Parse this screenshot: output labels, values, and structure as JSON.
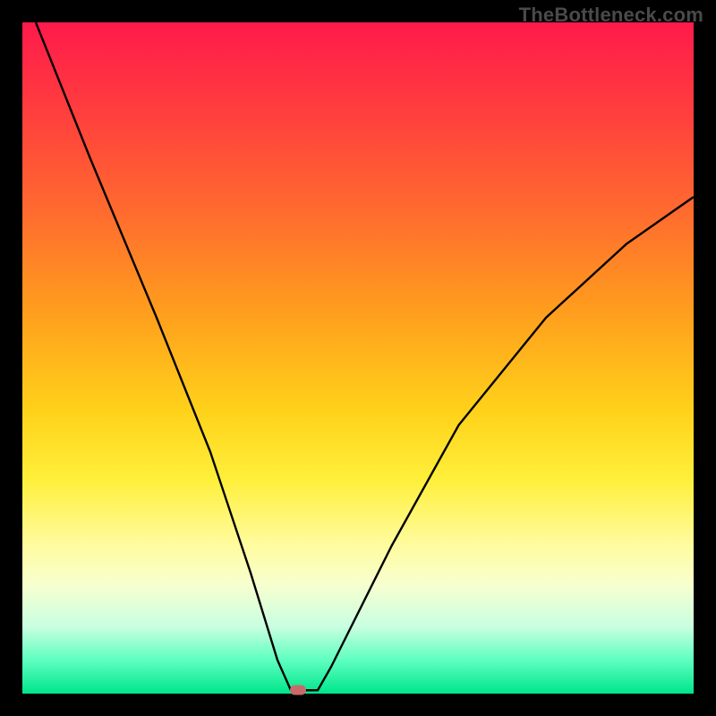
{
  "watermark": "TheBottleneck.com",
  "chart_data": {
    "type": "line",
    "title": "",
    "xlabel": "",
    "ylabel": "",
    "xlim": [
      0,
      100
    ],
    "ylim": [
      0,
      100
    ],
    "grid": false,
    "legend": false,
    "series": [
      {
        "name": "curve",
        "x": [
          2,
          10,
          20,
          28,
          34,
          38,
          40,
          42,
          44,
          46,
          55,
          65,
          78,
          90,
          100
        ],
        "values": [
          100,
          80,
          56,
          36,
          18,
          5,
          0.5,
          0.5,
          0.5,
          4,
          22,
          40,
          56,
          67,
          74
        ]
      }
    ],
    "marker": {
      "x": 41,
      "y": 0.5
    },
    "gradient_stops": [
      {
        "pos": 0,
        "color": "#ff1a4b"
      },
      {
        "pos": 12,
        "color": "#ff3a3f"
      },
      {
        "pos": 28,
        "color": "#ff6a2f"
      },
      {
        "pos": 42,
        "color": "#ff9a1e"
      },
      {
        "pos": 58,
        "color": "#ffd21a"
      },
      {
        "pos": 68,
        "color": "#ffef3a"
      },
      {
        "pos": 78,
        "color": "#fffca0"
      },
      {
        "pos": 84,
        "color": "#f6ffd0"
      },
      {
        "pos": 90,
        "color": "#c9ffe0"
      },
      {
        "pos": 95,
        "color": "#5effc0"
      },
      {
        "pos": 100,
        "color": "#00e58b"
      }
    ]
  }
}
